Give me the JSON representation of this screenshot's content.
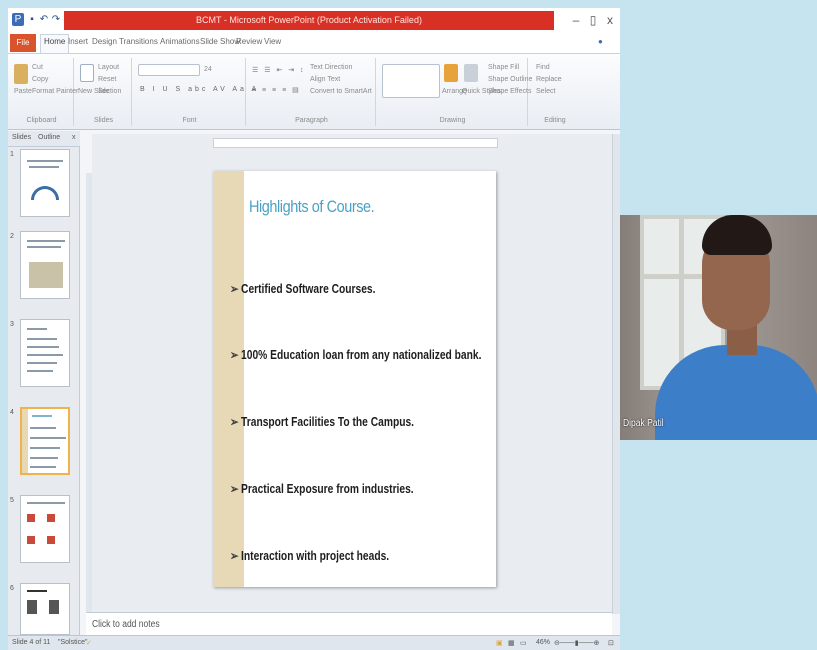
{
  "window": {
    "title": "BCMT - Microsoft PowerPoint (Product Activation Failed)",
    "minimize": "–",
    "maximize": "▯",
    "close": "x"
  },
  "ribbon_tabs": [
    "File",
    "Home",
    "Insert",
    "Design",
    "Transitions",
    "Animations",
    "Slide Show",
    "Review",
    "View"
  ],
  "ribbon_groups": {
    "clipboard": {
      "label": "Clipboard",
      "paste": "Paste",
      "cut": "Cut",
      "copy": "Copy",
      "format_painter": "Format Painter"
    },
    "slides": {
      "label": "Slides",
      "new_slide": "New Slide",
      "layout": "Layout",
      "reset": "Reset",
      "section": "Section"
    },
    "font": {
      "label": "Font",
      "font_size": "24"
    },
    "paragraph": {
      "label": "Paragraph",
      "text_direction": "Text Direction",
      "align_text": "Align Text",
      "convert": "Convert to SmartArt"
    },
    "drawing": {
      "label": "Drawing",
      "arrange": "Arrange",
      "quick_styles": "Quick Styles",
      "shape_fill": "Shape Fill",
      "shape_outline": "Shape Outline",
      "shape_effects": "Shape Effects"
    },
    "editing": {
      "label": "Editing",
      "find": "Find",
      "replace": "Replace",
      "select": "Select"
    }
  },
  "pane_tabs": {
    "slides": "Slides",
    "outline": "Outline"
  },
  "thumbnails": [
    {
      "num": "1"
    },
    {
      "num": "2"
    },
    {
      "num": "3"
    },
    {
      "num": "4"
    },
    {
      "num": "5"
    },
    {
      "num": "6"
    }
  ],
  "slide": {
    "title": "Highlights of Course.",
    "bullets": [
      "Certified Software  Courses.",
      "100% Education loan from  any nationalized bank.",
      "Transport Facilities To the Campus.",
      "Practical Exposure from industries.",
      "Interaction with project  heads."
    ]
  },
  "notes": {
    "placeholder": "Click to add notes"
  },
  "status": {
    "slide_info": "Slide 4 of 11",
    "theme": "\"Solstice\"",
    "zoom": "46%"
  },
  "webcam": {
    "participant_name": "Dipak Patil"
  },
  "colors": {
    "title_bar": "#d93025",
    "slide_title": "#4aa1c6",
    "slide_side_bar": "#e7d9b5"
  }
}
